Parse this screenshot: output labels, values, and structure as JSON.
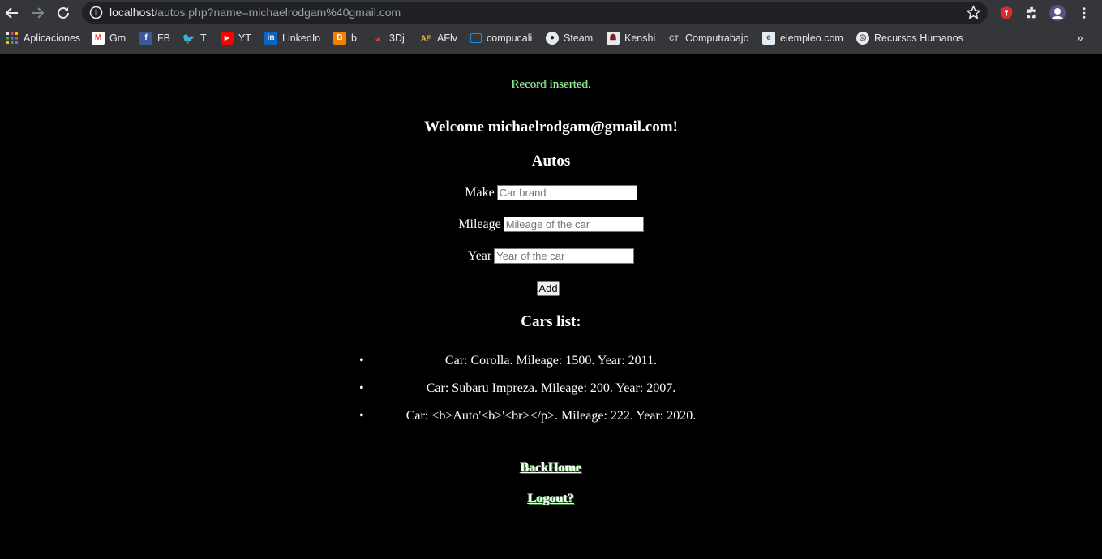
{
  "browser": {
    "url_host": "localhost",
    "url_path": "/autos.php?name=michaelrodgam%40gmail.com",
    "bookmarks": [
      {
        "label": "Aplicaciones",
        "icon": "apps-grid-icon",
        "color": "#e8eaed"
      },
      {
        "label": "Gm",
        "icon": "gmail-icon",
        "color": "#ea4335"
      },
      {
        "label": "FB",
        "icon": "facebook-icon",
        "color": "#3b5998"
      },
      {
        "label": "T",
        "icon": "twitter-icon",
        "color": "#1da1f2"
      },
      {
        "label": "YT",
        "icon": "youtube-icon",
        "color": "#ff0000"
      },
      {
        "label": "LinkedIn",
        "icon": "linkedin-icon",
        "color": "#0a66c2"
      },
      {
        "label": "b",
        "icon": "blogger-icon",
        "color": "#f57d00"
      },
      {
        "label": "3Dj",
        "icon": "3dj-icon",
        "color": "#c62828"
      },
      {
        "label": "AFlv",
        "icon": "aflv-icon",
        "color": "#222222"
      },
      {
        "label": "compucali",
        "icon": "compucali-icon",
        "color": "#1e88e5"
      },
      {
        "label": "Steam",
        "icon": "steam-icon",
        "color": "#1b2838"
      },
      {
        "label": "Kenshi",
        "icon": "kenshi-icon",
        "color": "#7b1f1f"
      },
      {
        "label": "Computrabajo",
        "icon": "computrabajo-icon",
        "color": "#333333"
      },
      {
        "label": "elempleo.com",
        "icon": "elempleo-icon",
        "color": "#1565c0"
      },
      {
        "label": "Recursos Humanos",
        "icon": "recursos-humanos-icon",
        "color": "#9e9e9e"
      }
    ]
  },
  "page": {
    "flash_message": "Record inserted.",
    "welcome": "Welcome michaelrodgam@gmail.com!",
    "title": "Autos",
    "form": {
      "make_label": "Make",
      "make_placeholder": "Car brand",
      "mileage_label": "Mileage",
      "mileage_placeholder": "Mileage of the car",
      "year_label": "Year",
      "year_placeholder": "Year of the car",
      "add_label": "Add"
    },
    "list_title": "Cars list:",
    "cars": [
      "Car: Corolla. Mileage: 1500. Year: 2011.",
      "Car: Subaru Impreza. Mileage: 200. Year: 2007.",
      "Car: <b>Auto'<b>'<br></p>. Mileage: 222. Year: 2020."
    ],
    "back_home_label": "BackHome",
    "logout_label": "Logout?"
  },
  "colors": {
    "flash": "#8ef58e",
    "page_background": "#000000",
    "chrome_background": "#35363a"
  }
}
